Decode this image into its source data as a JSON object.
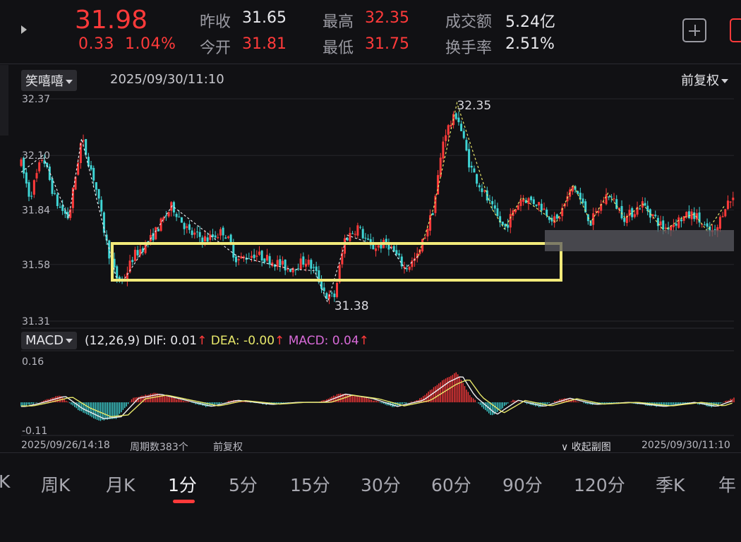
{
  "quote": {
    "price": "31.98",
    "change": "0.33",
    "change_pct": "1.04%",
    "prev_close_label": "昨收",
    "prev_close": "31.65",
    "open_label": "今开",
    "open": "31.81",
    "high_label": "最高",
    "high": "32.35",
    "low_label": "最低",
    "low": "31.75",
    "turnover_label": "成交额",
    "turnover": "5.24亿",
    "turnover_rate_label": "换手率",
    "turnover_rate": "2.51%"
  },
  "chart_header": {
    "indicator_select": "笑嘻嘻",
    "datetime": "2025/09/30/11:10",
    "adjust_select": "前复权"
  },
  "macd_header": {
    "select": "MACD",
    "params": "(12,26,9)",
    "dif": "DIF: 0.01",
    "dea": "DEA: -0.00",
    "macd": "MACD: 0.04",
    "up_arrow": "↑"
  },
  "footer": {
    "start": "2025/09/26/14:18",
    "period_count": "周期数383个",
    "adjust": "前复权",
    "collapse": "∨ 收起副图",
    "end": "2025/09/30/11:10"
  },
  "tabs": [
    "K",
    "周K",
    "月K",
    "1分",
    "5分",
    "15分",
    "30分",
    "60分",
    "90分",
    "120分",
    "季K",
    "年"
  ],
  "active_tab": "1分",
  "colors": {
    "up": "#ff3a3a",
    "down": "#3fd4d4",
    "dea": "#e8e86a",
    "macd": "#d86ad8",
    "box": "#f2ea7a"
  },
  "chart_data": {
    "type": "candlestick",
    "price_axis_ticks": [
      "32.37",
      "32.10",
      "31.84",
      "31.58",
      "31.31"
    ],
    "ylim": [
      31.31,
      32.37
    ],
    "annotations": {
      "high_label": "32.35",
      "low_label": "31.38"
    },
    "series_anchor_prices": [
      [
        0,
        32.06
      ],
      [
        10,
        31.9
      ],
      [
        25,
        32.1
      ],
      [
        40,
        31.88
      ],
      [
        55,
        31.8
      ],
      [
        70,
        32.18
      ],
      [
        85,
        31.98
      ],
      [
        100,
        31.66
      ],
      [
        110,
        31.52
      ],
      [
        118,
        31.5
      ],
      [
        130,
        31.62
      ],
      [
        150,
        31.7
      ],
      [
        175,
        31.86
      ],
      [
        195,
        31.73
      ],
      [
        215,
        31.7
      ],
      [
        235,
        31.74
      ],
      [
        250,
        31.6
      ],
      [
        270,
        31.63
      ],
      [
        290,
        31.6
      ],
      [
        310,
        31.56
      ],
      [
        330,
        31.6
      ],
      [
        340,
        31.55
      ],
      [
        355,
        31.42
      ],
      [
        363,
        31.43
      ],
      [
        375,
        31.7
      ],
      [
        390,
        31.76
      ],
      [
        405,
        31.66
      ],
      [
        425,
        31.68
      ],
      [
        445,
        31.56
      ],
      [
        460,
        31.62
      ],
      [
        478,
        31.85
      ],
      [
        490,
        32.2
      ],
      [
        505,
        32.3
      ],
      [
        520,
        32.05
      ],
      [
        545,
        31.85
      ],
      [
        560,
        31.75
      ],
      [
        580,
        31.9
      ],
      [
        600,
        31.87
      ],
      [
        620,
        31.78
      ],
      [
        640,
        31.96
      ],
      [
        660,
        31.78
      ],
      [
        680,
        31.92
      ],
      [
        700,
        31.8
      ],
      [
        720,
        31.87
      ],
      [
        745,
        31.75
      ],
      [
        765,
        31.8
      ],
      [
        780,
        31.82
      ],
      [
        795,
        31.74
      ],
      [
        805,
        31.73
      ],
      [
        815,
        31.86
      ],
      [
        826,
        31.9
      ]
    ],
    "macd_axis_ticks": [
      "0.16",
      "-0.11"
    ],
    "macd_ylim": [
      -0.11,
      0.16
    ],
    "macd_anchor_values": [
      [
        0,
        -0.02
      ],
      [
        20,
        0.0
      ],
      [
        45,
        0.03
      ],
      [
        65,
        -0.03
      ],
      [
        90,
        -0.08
      ],
      [
        110,
        -0.07
      ],
      [
        130,
        0.02
      ],
      [
        155,
        0.04
      ],
      [
        185,
        0.01
      ],
      [
        215,
        -0.02
      ],
      [
        245,
        0.01
      ],
      [
        285,
        -0.01
      ],
      [
        315,
        0.0
      ],
      [
        345,
        0.0
      ],
      [
        370,
        0.04
      ],
      [
        400,
        0.02
      ],
      [
        430,
        -0.02
      ],
      [
        460,
        0.01
      ],
      [
        490,
        0.1
      ],
      [
        505,
        0.13
      ],
      [
        520,
        0.03
      ],
      [
        545,
        -0.06
      ],
      [
        570,
        0.01
      ],
      [
        600,
        -0.02
      ],
      [
        630,
        0.02
      ],
      [
        660,
        -0.01
      ],
      [
        700,
        0.0
      ],
      [
        740,
        -0.02
      ],
      [
        775,
        0.0
      ],
      [
        800,
        -0.02
      ],
      [
        826,
        0.02
      ]
    ]
  }
}
